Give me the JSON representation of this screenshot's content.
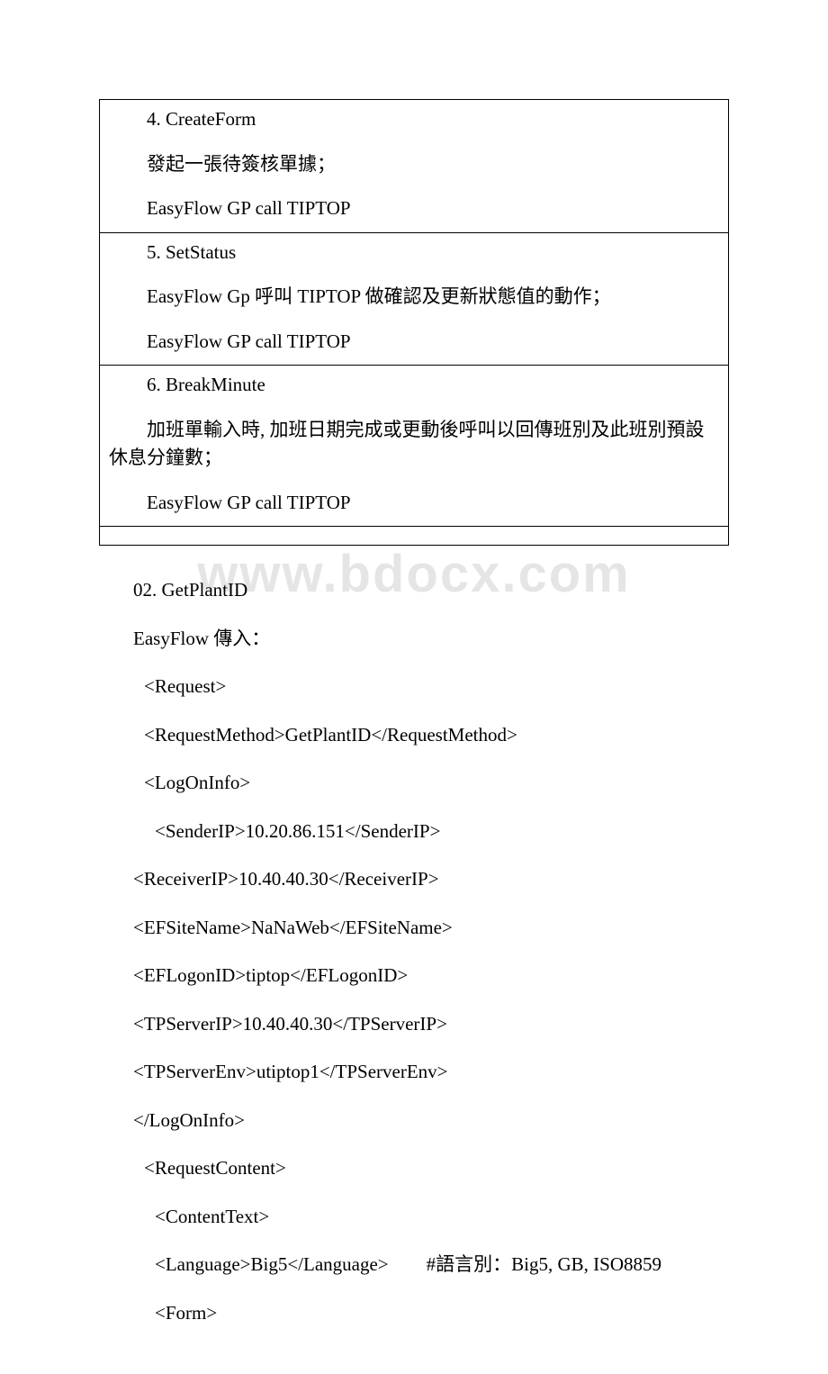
{
  "watermark": "www.bdocx.com",
  "table": {
    "rows": [
      {
        "id": "row-4",
        "lines": [
          "4. CreateForm",
          "發起一張待簽核單據；",
          "EasyFlow GP call TIPTOP"
        ]
      },
      {
        "id": "row-5",
        "lines": [
          "5. SetStatus",
          "EasyFlow Gp 呼叫 TIPTOP 做確認及更新狀態值的動作；",
          "EasyFlow GP call TIPTOP"
        ]
      },
      {
        "id": "row-6",
        "lines": [
          "6. BreakMinute",
          "加班單輸入時, 加班日期完成或更動後呼叫以回傳班別及此班別預設休息分鐘數；",
          "EasyFlow GP call TIPTOP"
        ]
      },
      {
        "id": "row-empty",
        "lines": []
      }
    ]
  },
  "body": {
    "heading": "02. GetPlantID",
    "subheading": "EasyFlow 傳入：",
    "lines": [
      {
        "indent": "i1",
        "text": "<Request>"
      },
      {
        "indent": "i1",
        "text": "<RequestMethod>GetPlantID</RequestMethod>"
      },
      {
        "indent": "i1",
        "text": "<LogOnInfo>"
      },
      {
        "indent": "i2",
        "text": "<SenderIP>10.20.86.151</SenderIP>"
      },
      {
        "indent": "i0",
        "text": "<ReceiverIP>10.40.40.30</ReceiverIP>"
      },
      {
        "indent": "i0",
        "text": "<EFSiteName>NaNaWeb</EFSiteName>"
      },
      {
        "indent": "i0",
        "text": "<EFLogonID>tiptop</EFLogonID>"
      },
      {
        "indent": "i0",
        "text": "<TPServerIP>10.40.40.30</TPServerIP>"
      },
      {
        "indent": "i0",
        "text": "<TPServerEnv>utiptop1</TPServerEnv>"
      },
      {
        "indent": "i0",
        "text": "</LogOnInfo>"
      },
      {
        "indent": "i1",
        "text": "<RequestContent>"
      },
      {
        "indent": "i2",
        "text": "<ContentText>"
      },
      {
        "indent": "i2",
        "text": "<Language>Big5</Language>　　#語言別：Big5, GB, ISO8859"
      },
      {
        "indent": "i2",
        "text": "<Form>"
      }
    ]
  }
}
